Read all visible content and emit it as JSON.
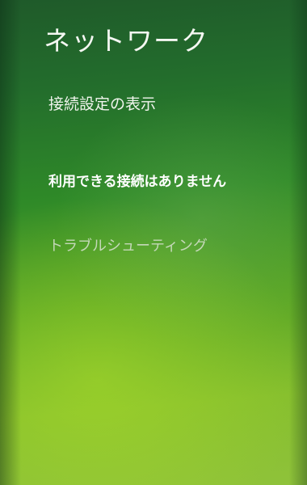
{
  "panel": {
    "title": "ネットワーク",
    "connection_settings_label": "接続設定の表示",
    "status_text": "利用できる接続はありません",
    "troubleshoot_label": "トラブルシューティング"
  },
  "colors": {
    "background_top": "#1f5a2a",
    "background_bottom": "#8fc23a",
    "text": "#ffffff",
    "disabled_text": "#c4d8b8"
  }
}
